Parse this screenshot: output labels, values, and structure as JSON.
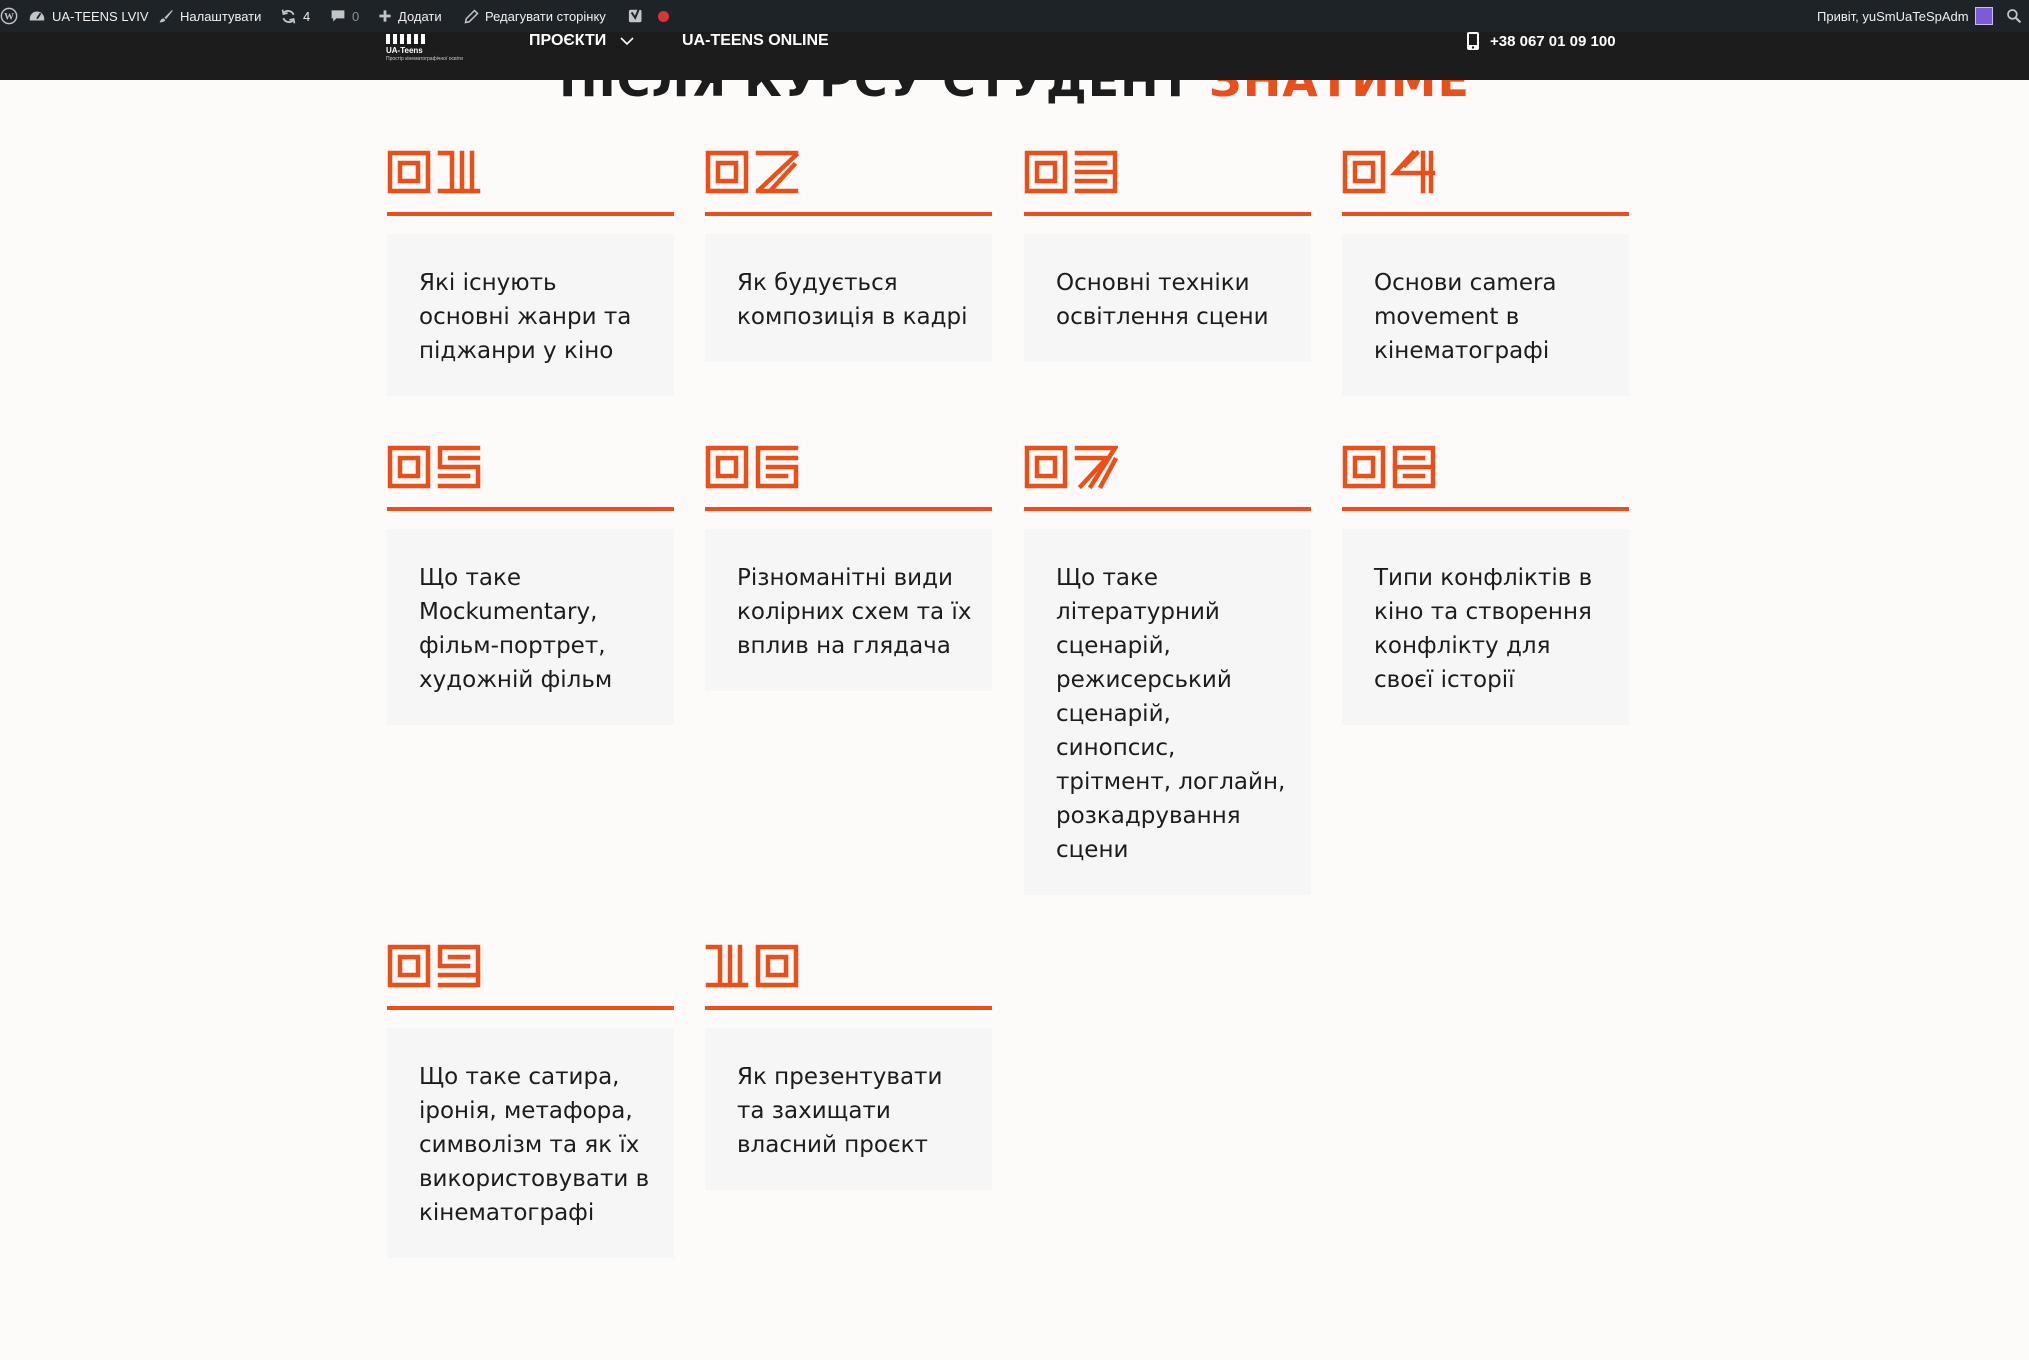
{
  "admin_bar": {
    "site_name": "UA-TEENS LVIV",
    "customize": "Налаштувати",
    "updates_count": "4",
    "comments_count": "0",
    "add_new": "Додати",
    "edit_page": "Редагувати сторінку",
    "greeting": "Привіт, yuSmUaTeSpAdm",
    "colors": {
      "bar": "#1d2327",
      "recording": "#d63638"
    }
  },
  "header": {
    "logo_name": "UA-Teens",
    "logo_tagline": "Простір кінематографічної освіти",
    "nav": [
      {
        "label": "ПРОЄКТИ",
        "has_dropdown": true
      },
      {
        "label": "UA-TEENS ONLINE",
        "has_dropdown": false
      }
    ],
    "phone": "+38 067 01 09 100"
  },
  "section": {
    "heading_main": "ПІСЛЯ КУРСУ СТУДЕНТ",
    "heading_accent": "ЗНАТИМЕ",
    "accent_color": "#ea4f1a",
    "items": [
      {
        "number": "01",
        "text": "Які існують основні жанри та піджанри у кіно"
      },
      {
        "number": "02",
        "text": "Як будується композиція в кадрі"
      },
      {
        "number": "03",
        "text": "Основні техніки освітлення сцени"
      },
      {
        "number": "04",
        "text": "Основи camera movement в кінематографі"
      },
      {
        "number": "05",
        "text": "Що таке Mockumentary, фільм-портрет, художній фільм"
      },
      {
        "number": "06",
        "text": "Різноманітні види колірних схем та їх вплив на глядача"
      },
      {
        "number": "07",
        "text": "Що таке літературний сценарій, режисерський сценарій, синопсис, трітмент, логлайн, розкадрування сцени"
      },
      {
        "number": "08",
        "text": "Типи конфліктів в кіно та створення конфлікту для своєї історії"
      },
      {
        "number": "09",
        "text": "Що таке сатира, іронія, метафора, символізм та як їх використовувати в кінематографі"
      },
      {
        "number": "10",
        "text": "Як презентувати та захищати власний проєкт"
      }
    ]
  }
}
